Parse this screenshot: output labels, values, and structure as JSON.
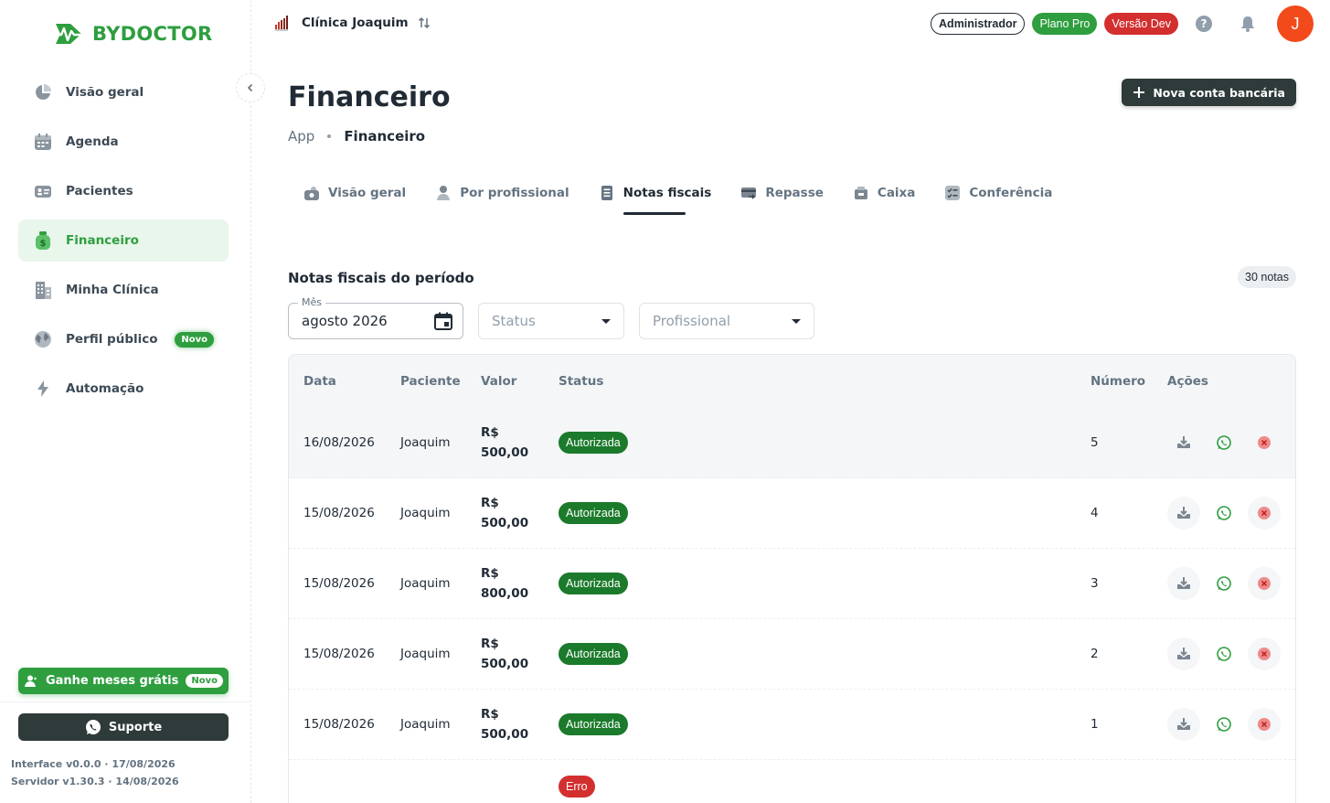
{
  "brand": {
    "name": "BYDOCTOR",
    "color": "#2e9e3f"
  },
  "sidebar": {
    "items": [
      {
        "label": "Visão geral",
        "icon": "pie-chart-icon",
        "active": false
      },
      {
        "label": "Agenda",
        "icon": "calendar-icon",
        "active": false
      },
      {
        "label": "Pacientes",
        "icon": "id-card-icon",
        "active": false
      },
      {
        "label": "Financeiro",
        "icon": "money-bag-icon",
        "active": true
      },
      {
        "label": "Minha Clínica",
        "icon": "building-icon",
        "active": false
      },
      {
        "label": "Perfil público",
        "icon": "globe-icon",
        "active": false,
        "badge": "Novo"
      },
      {
        "label": "Automação",
        "icon": "lightning-icon",
        "active": false
      }
    ],
    "gift_button": {
      "label": "Ganhe meses grátis",
      "badge": "Novo"
    },
    "support_button": {
      "label": "Suporte"
    },
    "interface_version": "Interface v0.0.0 · 17/08/2026",
    "server_version": "Servidor v1.30.3 · 14/08/2026"
  },
  "header": {
    "clinic_name": "Clínica Joaquim",
    "role_badge": "Administrador",
    "plan_badge": "Plano Pro",
    "version_badge": "Versão Dev",
    "avatar_letter": "J"
  },
  "page": {
    "title": "Financeiro",
    "breadcrumb": [
      "App",
      "Financeiro"
    ],
    "new_account_button": "Nova conta bancária"
  },
  "tabs": [
    {
      "label": "Visão geral",
      "icon": "wallet-icon",
      "active": false
    },
    {
      "label": "Por profissional",
      "icon": "user-icon",
      "active": false
    },
    {
      "label": "Notas fiscais",
      "icon": "receipt-icon",
      "active": true
    },
    {
      "label": "Repasse",
      "icon": "transfer-icon",
      "active": false
    },
    {
      "label": "Caixa",
      "icon": "cash-register-icon",
      "active": false
    },
    {
      "label": "Conferência",
      "icon": "checklist-icon",
      "active": false
    }
  ],
  "section": {
    "title": "Notas fiscais do período",
    "count": "30 notas"
  },
  "filters": {
    "month_label": "Mês",
    "month_value": "agosto 2026",
    "status_placeholder": "Status",
    "professional_placeholder": "Profissional"
  },
  "table": {
    "headers": {
      "date": "Data",
      "patient": "Paciente",
      "value": "Valor",
      "status": "Status",
      "number": "Número",
      "actions": "Ações"
    },
    "rows": [
      {
        "date": "16/08/2026",
        "patient": "Joaquim",
        "currency": "R$",
        "amount": "500,00",
        "status": "Autorizada",
        "number": "5"
      },
      {
        "date": "15/08/2026",
        "patient": "Joaquim",
        "currency": "R$",
        "amount": "500,00",
        "status": "Autorizada",
        "number": "4"
      },
      {
        "date": "15/08/2026",
        "patient": "Joaquim",
        "currency": "R$",
        "amount": "800,00",
        "status": "Autorizada",
        "number": "3"
      },
      {
        "date": "15/08/2026",
        "patient": "Joaquim",
        "currency": "R$",
        "amount": "500,00",
        "status": "Autorizada",
        "number": "2"
      },
      {
        "date": "15/08/2026",
        "patient": "Joaquim",
        "currency": "R$",
        "amount": "500,00",
        "status": "Autorizada",
        "number": "1"
      }
    ],
    "partial_row_status": "Erro"
  }
}
